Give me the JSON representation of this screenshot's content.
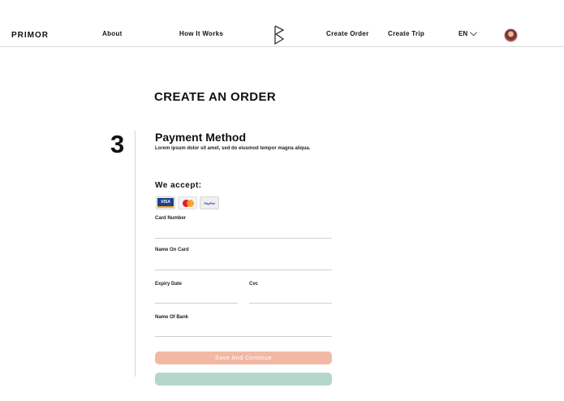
{
  "navbar": {
    "brand": "PRIMOR",
    "links": [
      {
        "label": "About"
      },
      {
        "label": "How It Works"
      },
      {
        "label": "Create Order"
      },
      {
        "label": "Create Trip"
      }
    ],
    "logo_icon": "primor-logo-icon",
    "language": "EN",
    "language_icon": "chevron-down-icon",
    "avatar_icon": "user-avatar"
  },
  "page": {
    "title": "CREATE AN ORDER"
  },
  "step": {
    "number": "3",
    "title": "Payment Method",
    "description": "Lorem ipsum dolor sit amet, sed do eiusmod tempor magna aliqua.",
    "accept_title": "We accept:",
    "payment_methods": [
      {
        "name": "visa",
        "text": "VISA",
        "icon": "visa-icon"
      },
      {
        "name": "mastercard",
        "icon": "mastercard-icon"
      },
      {
        "name": "paypal",
        "text": "PayPal",
        "icon": "paypal-icon"
      }
    ]
  },
  "form": {
    "card_number": {
      "label": "Card Number",
      "value": ""
    },
    "name_on_card": {
      "label": "Name On Card",
      "value": ""
    },
    "expiry_date": {
      "label": "Expiry Date",
      "value": ""
    },
    "cvc": {
      "label": "Cvc",
      "value": ""
    },
    "bank_name": {
      "label": "Name Of Bank",
      "value": ""
    },
    "save_button": "Save And Continue"
  },
  "colors": {
    "save_button_bg": "#f2b8a4",
    "secondary_button_bg": "#b5d6cc",
    "divider": "#d9d9d9"
  }
}
